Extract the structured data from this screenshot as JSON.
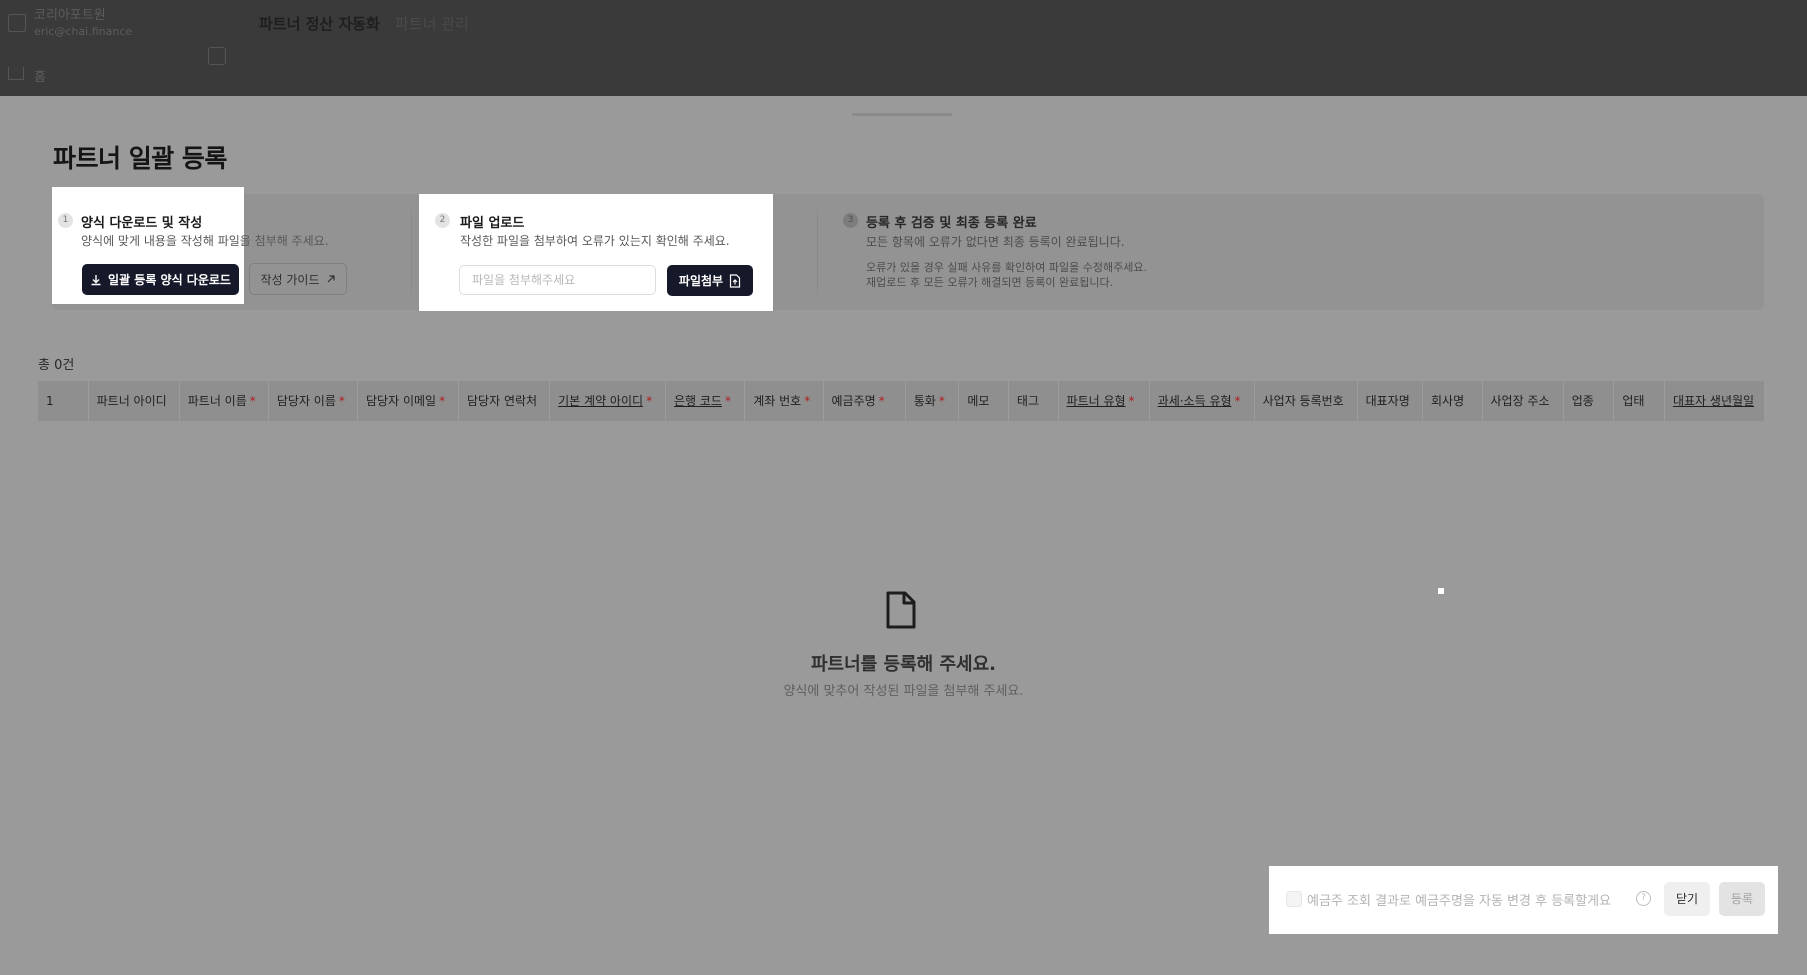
{
  "org": {
    "name": "코리아포트원",
    "email": "eric@chai.finance"
  },
  "nav": {
    "home": "홈"
  },
  "tabs": [
    {
      "label": "파트너 정산 자동화"
    },
    {
      "label": "파트너 관리"
    }
  ],
  "page": {
    "title": "파트너 일괄 등록"
  },
  "steps": [
    {
      "num": "1",
      "title": "양식 다운로드 및 작성",
      "desc": "양식에 맞게 내용을 작성해 파일을 첨부해 주세요.",
      "download_label": "일괄 등록 양식 다운로드",
      "guide_label": "작성 가이드"
    },
    {
      "num": "2",
      "title": "파일 업로드",
      "desc": "작성한 파일을 첨부하여 오류가 있는지 확인해 주세요.",
      "input_placeholder": "파일을 첨부해주세요",
      "attach_label": "파일첨부"
    },
    {
      "num": "3",
      "title": "등록 후 검증 및 최종 등록 완료",
      "desc": "모든 항목에 오류가 없다면 최종 등록이 완료됩니다.",
      "note1": "오류가 있을 경우 실패 사유를 확인하여 파일을 수정해주세요.",
      "note2": "재업로드 후 모든 오류가 해결되면 등록이 완료됩니다."
    }
  ],
  "table": {
    "count_label": "총 0건",
    "columns": [
      {
        "label": "1",
        "required": false,
        "link": false
      },
      {
        "label": "파트너 아이디",
        "required": false,
        "link": false
      },
      {
        "label": "파트너 이름",
        "required": true,
        "link": false
      },
      {
        "label": "담당자 이름",
        "required": true,
        "link": false
      },
      {
        "label": "담당자 이메일",
        "required": true,
        "link": false
      },
      {
        "label": "담당자 연락처",
        "required": false,
        "link": false
      },
      {
        "label": "기본 계약 아이디",
        "required": true,
        "link": true
      },
      {
        "label": "은행 코드",
        "required": true,
        "link": true
      },
      {
        "label": "계좌 번호",
        "required": true,
        "link": false
      },
      {
        "label": "예금주명",
        "required": true,
        "link": false
      },
      {
        "label": "통화",
        "required": true,
        "link": false
      },
      {
        "label": "메모",
        "required": false,
        "link": false
      },
      {
        "label": "태그",
        "required": false,
        "link": false
      },
      {
        "label": "파트너 유형",
        "required": true,
        "link": true
      },
      {
        "label": "과세·소득 유형",
        "required": true,
        "link": true
      },
      {
        "label": "사업자 등록번호",
        "required": false,
        "link": false
      },
      {
        "label": "대표자명",
        "required": false,
        "link": false
      },
      {
        "label": "회사명",
        "required": false,
        "link": false
      },
      {
        "label": "사업장 주소",
        "required": false,
        "link": false
      },
      {
        "label": "업종",
        "required": false,
        "link": false
      },
      {
        "label": "업태",
        "required": false,
        "link": false
      },
      {
        "label": "대표자 생년월일",
        "required": false,
        "link": true
      }
    ]
  },
  "empty": {
    "title": "파트너를 등록해 주세요.",
    "desc": "양식에 맞추어 작성된 파일을 첨부해 주세요."
  },
  "footer": {
    "checkbox_label": "예금주 조회 결과로 예금주명을 자동 변경 후 등록할게요",
    "close_label": "닫기",
    "register_label": "등록"
  }
}
